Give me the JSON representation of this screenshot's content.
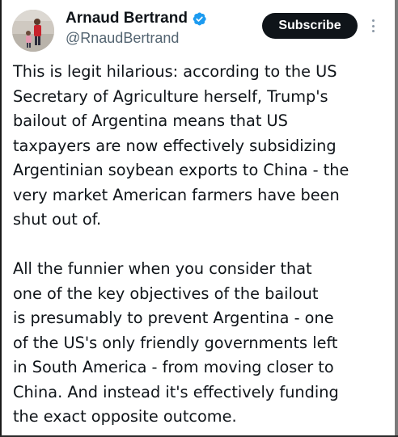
{
  "author": {
    "display_name": "Arnaud Bertrand",
    "handle": "@RnaudBertrand",
    "verified": true
  },
  "actions": {
    "subscribe_label": "Subscribe",
    "more_icon": "more-vertical-icon"
  },
  "post": {
    "paragraphs": [
      {
        "lines": [
          "This is legit hilarious: according to the US",
          "Secretary of Agriculture herself, Trump's",
          "bailout of Argentina means that US",
          "taxpayers are now effectively subsidizing",
          "Argentinian soybean exports to China - the",
          "very market American farmers have been",
          "shut out of."
        ]
      },
      {
        "lines": [
          "All the funnier when you consider that",
          "one of the key objectives of the bailout",
          "is presumably to prevent Argentina - one",
          "of the US's only friendly governments left",
          "in South America - from moving closer to",
          "China. And instead it's effectively funding",
          "the exact opposite outcome."
        ]
      }
    ]
  },
  "colors": {
    "text_primary": "#0f1419",
    "text_secondary": "#536471",
    "verified_badge": "#1d9bf0",
    "subscribe_bg": "#0f1419"
  }
}
